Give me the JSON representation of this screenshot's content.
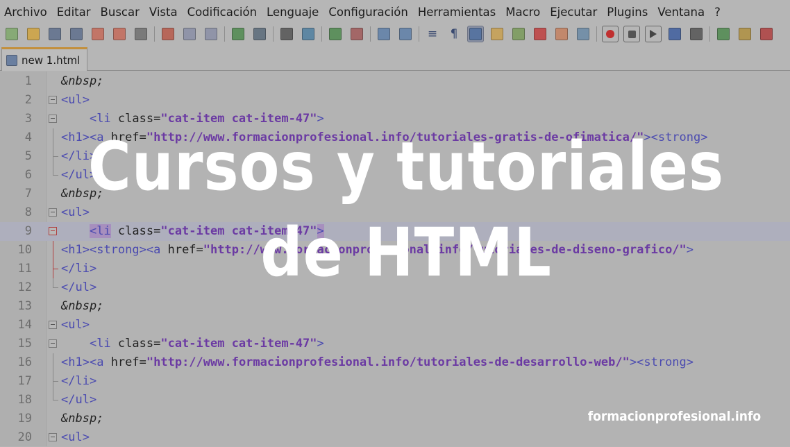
{
  "menu": [
    "Archivo",
    "Editar",
    "Buscar",
    "Vista",
    "Codificación",
    "Lenguaje",
    "Configuración",
    "Herramientas",
    "Macro",
    "Ejecutar",
    "Plugins",
    "Ventana",
    "?"
  ],
  "toolbar": {
    "icons": [
      "new-file-icon",
      "open-file-icon",
      "save-icon",
      "save-all-icon",
      "close-icon",
      "close-all-icon",
      "print-icon",
      "cut-icon",
      "copy-icon",
      "paste-icon",
      "undo-icon",
      "redo-icon",
      "find-icon",
      "replace-icon",
      "zoom-in-icon",
      "zoom-out-icon",
      "sync-vertical-icon",
      "sync-horizontal-icon",
      "word-wrap-icon",
      "show-all-characters-icon",
      "indent-guide-icon",
      "user-defined-language-icon",
      "doc-map-icon",
      "function-list-icon",
      "folder-workspace-icon",
      "monitoring-icon",
      "record-macro-icon",
      "stop-recording-icon",
      "playback-macro-icon",
      "run-macro-multiple-icon",
      "save-macro-icon",
      "spell-check-icon",
      "spell-check-toggle-icon",
      "spell-check-abc-icon"
    ],
    "glyphs": {
      "word-wrap-icon": "≡",
      "show-all-characters-icon": "¶"
    }
  },
  "tabs": [
    {
      "label": "new 1.html",
      "active": true
    }
  ],
  "editor": {
    "lines": [
      {
        "n": "1",
        "code": "&nbsp;"
      },
      {
        "n": "2",
        "code": "<ul>"
      },
      {
        "n": "3",
        "code": "    <li class=\"cat-item cat-item-47\">"
      },
      {
        "n": "4",
        "code": "<h1><a href=\"http://www.formacionprofesional.info/tutoriales-gratis-de-ofimatica/\"><strong>"
      },
      {
        "n": "5",
        "code": "</li>"
      },
      {
        "n": "6",
        "code": "</ul>"
      },
      {
        "n": "7",
        "code": "&nbsp;"
      },
      {
        "n": "8",
        "code": "<ul>"
      },
      {
        "n": "9",
        "code": "    <li class=\"cat-item cat-item-47\">"
      },
      {
        "n": "10",
        "code": "<h1><strong><a href=\"http://www.formacionprofesional.info/tutoriales-de-diseno-grafico/\">"
      },
      {
        "n": "11",
        "code": "</li>"
      },
      {
        "n": "12",
        "code": "</ul>"
      },
      {
        "n": "13",
        "code": "&nbsp;"
      },
      {
        "n": "14",
        "code": "<ul>"
      },
      {
        "n": "15",
        "code": "    <li class=\"cat-item cat-item-47\">"
      },
      {
        "n": "16",
        "code": "<h1><a href=\"http://www.formacionprofesional.info/tutoriales-de-desarrollo-web/\"><strong>"
      },
      {
        "n": "17",
        "code": "</li>"
      },
      {
        "n": "18",
        "code": "</ul>"
      },
      {
        "n": "19",
        "code": "&nbsp;"
      },
      {
        "n": "20",
        "code": "<ul>"
      }
    ],
    "current_line": "9"
  },
  "overlay": {
    "title_line1": "Cursos y tutoriales",
    "title_line2": "de HTML",
    "watermark": "formacionprofesional.info"
  },
  "colors": {
    "tag": "#4b4bb0",
    "attribute": "#c04a3a",
    "string": "#6b3aa3",
    "tab_accent": "#c38f3c",
    "overlay_text": "#ffffff"
  }
}
